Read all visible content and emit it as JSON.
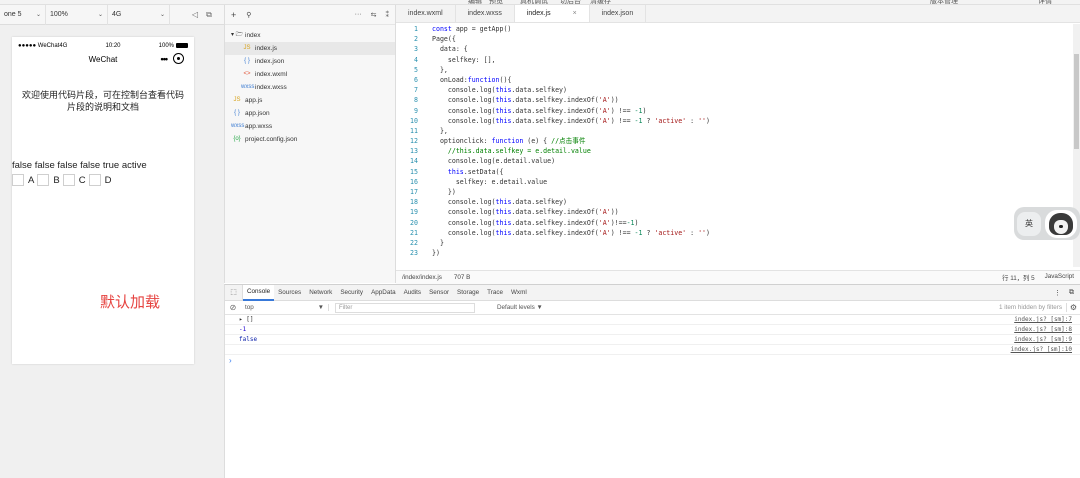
{
  "topstrip": {
    "items": [
      "编辑",
      "预览",
      "真机调试",
      "切后台",
      "清缓存",
      "版本管理",
      "详情"
    ]
  },
  "simulator": {
    "device": "one 5",
    "zoom": "100%",
    "network": "4G",
    "status": {
      "carrier": "●●●●● WeChat",
      "network": "4G",
      "time": "10:20",
      "battery": "100%"
    },
    "nav_title": "WeChat",
    "capsule_dots": "•••",
    "intro": "欢迎使用代码片段，可在控制台查看代码片段的说明和文档",
    "result_line": "false false false false true active",
    "checkboxes": [
      "A",
      "B",
      "C",
      "D"
    ],
    "red_text": "默认加载"
  },
  "filetree": {
    "add": "+",
    "search": "🔍",
    "more": "···",
    "items": [
      {
        "icon": "▾ 🗁",
        "name": "index",
        "indent": 0,
        "color": "#333"
      },
      {
        "icon": "JS",
        "name": "index.js",
        "indent": 1,
        "color": "#d7a21a",
        "selected": true
      },
      {
        "icon": "{ }",
        "name": "index.json",
        "indent": 1,
        "color": "#3b7bd1"
      },
      {
        "icon": "<>",
        "name": "index.wxml",
        "indent": 1,
        "color": "#e0573b"
      },
      {
        "icon": "wxss",
        "name": "index.wxss",
        "indent": 1,
        "color": "#3b7bd1"
      },
      {
        "icon": "JS",
        "name": "app.js",
        "indent": 0,
        "color": "#d7a21a"
      },
      {
        "icon": "{ }",
        "name": "app.json",
        "indent": 0,
        "color": "#3b7bd1"
      },
      {
        "icon": "wxss",
        "name": "app.wxss",
        "indent": 0,
        "color": "#3b7bd1"
      },
      {
        "icon": "{o}",
        "name": "project.config.json",
        "indent": 0,
        "color": "#2aa84a"
      }
    ]
  },
  "editor": {
    "tabs": [
      {
        "label": "index.wxml",
        "active": false
      },
      {
        "label": "index.wxss",
        "active": false
      },
      {
        "label": "index.js",
        "active": true,
        "close": "×"
      },
      {
        "label": "index.json",
        "active": false
      }
    ],
    "lines": [
      "const app = getApp()",
      "Page({",
      "  data: {",
      "    selfkey: [],",
      "  },",
      "  onLoad:function(){",
      "    console.log(this.data.selfkey)",
      "    console.log(this.data.selfkey.indexOf('A'))",
      "    console.log(this.data.selfkey.indexOf('A') !== -1)",
      "    console.log(this.data.selfkey.indexOf('A') !== -1 ? 'active' : '')",
      "  },",
      "  optionclick: function (e) { //点击事件",
      "    //this.data.selfkey = e.detail.value",
      "    console.log(e.detail.value)",
      "    this.setData({",
      "      selfkey: e.detail.value",
      "    })",
      "    console.log(this.data.selfkey)",
      "    console.log(this.data.selfkey.indexOf('A'))",
      "    console.log(this.data.selfkey.indexOf('A')!==-1)",
      "    console.log(this.data.selfkey.indexOf('A') !== -1 ? 'active' : '')",
      "  }",
      "})"
    ],
    "status": {
      "path": "/index/index.js",
      "size": "707 B",
      "position": "行 11，列 5",
      "language": "JavaScript"
    }
  },
  "ime": {
    "lang": "英"
  },
  "devtools": {
    "tabs": [
      "Console",
      "Sources",
      "Network",
      "Security",
      "AppData",
      "Audits",
      "Sensor",
      "Storage",
      "Trace",
      "Wxml"
    ],
    "active_tab": "Console",
    "context": "top",
    "filter_placeholder": "Filter",
    "levels": "Default levels ▼",
    "hidden_info": "1 item hidden by filters",
    "messages": [
      {
        "text": "▸ []",
        "source": "index.js? [sm]:7",
        "kind": "arr"
      },
      {
        "text": "-1",
        "source": "index.js? [sm]:8",
        "kind": "n"
      },
      {
        "text": "false",
        "source": "index.js? [sm]:9",
        "kind": "b"
      },
      {
        "text": "",
        "source": "index.js? [sm]:10",
        "kind": "e"
      }
    ],
    "prompt": "›"
  }
}
